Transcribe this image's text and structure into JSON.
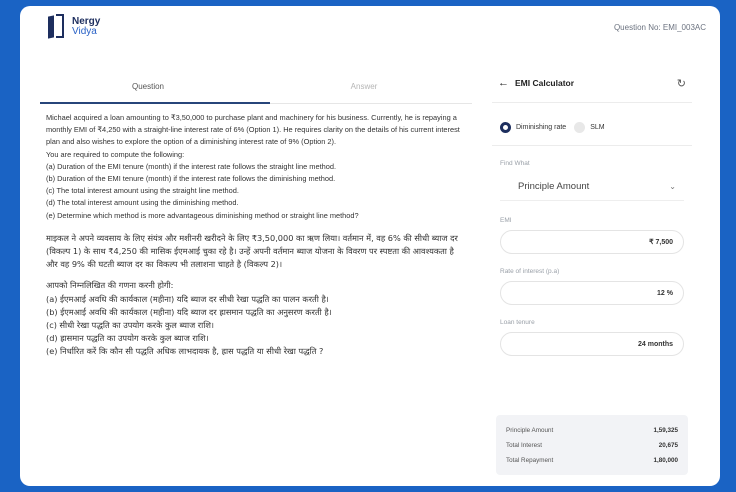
{
  "header": {
    "logo_line1": "Nergy",
    "logo_line2": "Vidya",
    "question_no": "Question No: EMI_003AC"
  },
  "tabs": [
    {
      "label": "Question",
      "active": true
    },
    {
      "label": "Answer",
      "active": false
    }
  ],
  "question_en": [
    "Michael acquired a loan amounting to ₹3,50,000 to purchase plant and machinery for his business. Currently, he is repaying a monthly EMI of ₹4,250 with a straight-line interest rate of 6% (Option 1). He requires clarity on the details of his current interest plan and also wishes to explore the option of a diminishing interest rate of 9% (Option 2).",
    "You are required to compute the following:",
    "(a) Duration of the EMI tenure (month) if the interest rate follows the straight line method.",
    "(b) Duration of the EMI tenure (month) if the interest rate follows the diminishing method.",
    "(c) The total interest amount using the straight line method.",
    "(d) The total interest amount using the diminishing method.",
    "(e) Determine which method is more advantageous diminishing method or straight line method?"
  ],
  "question_hi_intro": "माइकल ने अपने व्यवसाय के लिए संयंत्र और मशीनरी खरीदने के लिए ₹3,50,000 का ऋण लिया। वर्तमान में, वह 6% की सीधी ब्याज दर (विकल्प 1) के साथ ₹4,250 की मासिक ईएमआई चुका रहे है। उन्हें अपनी वर्तमान ब्याज योजना के विवरण पर स्पष्टता की आवश्यकता है और वह 9% की घटती ब्याज दर का विकल्प भी तलाशना चाहते है (विकल्प 2)।",
  "question_hi_list": [
    "आपको निम्नलिखित की गणना करनी होगी:",
    "(a) ईएमआई अवधि की कार्यकाल (महीना) यदि ब्याज दर सीधी रेखा पद्धति का पालन करती है।",
    "(b) ईएमआई अवधि की कार्यकाल (महीना) यदि ब्याज दर ह्रासमान पद्धति का अनुसरण करती है।",
    "(c) सीधी रेखा पद्धति का उपयोग करके कुल ब्याज राशि।",
    "(d) ह्रासमान पद्धति का उपयोग करके कुल ब्याज राशि।",
    "(e) निर्धारित करें कि कौन सी पद्धति अधिक लाभदायक है, ह्रास पद्धति या सीधी रेखा पद्धति ?"
  ],
  "calculator": {
    "title": "EMI Calculator",
    "options": [
      {
        "label": "Diminishing rate",
        "selected": true
      },
      {
        "label": "SLM",
        "selected": false
      }
    ],
    "find_label": "Find What",
    "find_value": "Principle Amount",
    "emi_label": "EMI",
    "emi_value": "₹ 7,500",
    "rate_label": "Rate of interest (p.a)",
    "rate_value": "12 %",
    "tenure_label": "Loan tenure",
    "tenure_value": "24 months",
    "summary": [
      {
        "label": "Principle Amount",
        "value": "1,59,325"
      },
      {
        "label": "Total Interest",
        "value": "20,675"
      },
      {
        "label": "Total Repayment",
        "value": "1,80,000"
      }
    ]
  }
}
